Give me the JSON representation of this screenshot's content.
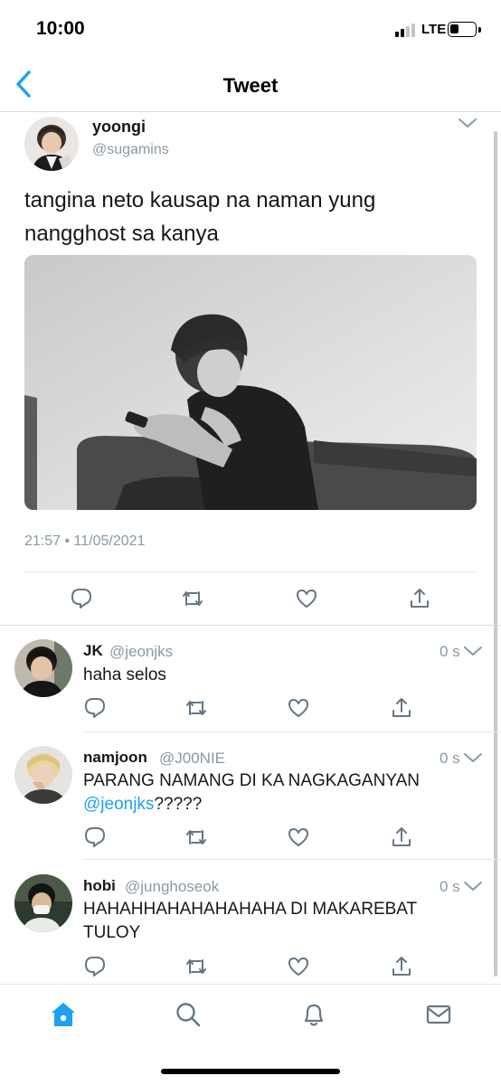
{
  "status_bar": {
    "time": "10:00",
    "network": "LTE",
    "battery_percent": 35
  },
  "nav": {
    "title": "Tweet",
    "back_icon": "chevron-left-icon"
  },
  "main_tweet": {
    "name": "yoongi",
    "handle": "@sugamins",
    "text": "tangina neto kausap na naman yung nangghost sa kanya",
    "timestamp": "21:57 • 11/05/2021",
    "actions": [
      "reply-icon",
      "retweet-icon",
      "like-icon",
      "share-icon"
    ]
  },
  "replies": [
    {
      "name": "JK",
      "handle": "@jeonjks",
      "time": "0 s",
      "text": "haha selos",
      "mention": "",
      "text_after": ""
    },
    {
      "name": "namjoon",
      "handle": "@J00NIE",
      "time": "0 s",
      "text": "PARANG NAMANG DI KA NAGKAGANYAN ",
      "mention": "@jeonjks",
      "text_after": "?????"
    },
    {
      "name": "hobi",
      "handle": "@junghoseok",
      "time": "0 s",
      "text": "HAHAHHAHAHAHAHAHA DI MAKAREBAT TULOY",
      "mention": "",
      "text_after": ""
    }
  ],
  "tab_bar": {
    "tabs": [
      "home-icon",
      "search-icon",
      "notifications-icon",
      "messages-icon"
    ],
    "active": "home-icon"
  },
  "colors": {
    "accent": "#1da1f2",
    "text": "#14171a",
    "secondary": "#8899a6",
    "icon": "#657786"
  }
}
